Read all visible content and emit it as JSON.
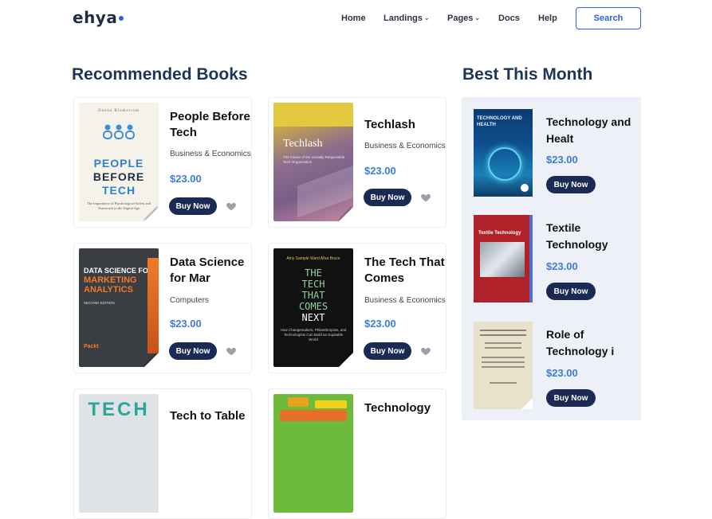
{
  "brand": {
    "logo": "ehya"
  },
  "nav": {
    "home": "Home",
    "landings": "Landings",
    "pages": "Pages",
    "docs": "Docs",
    "help": "Help",
    "search": "Search"
  },
  "recommended": {
    "title": "Recommended Books",
    "books": [
      {
        "title_line1": "People Before",
        "title_line2": "Tech",
        "category": "Business & Economics",
        "price": "$23.00",
        "buy": "Buy Now",
        "cover_author": "Duena Blomstrom",
        "cover_title": [
          "PEOPLE",
          "BEFORE",
          "TECH"
        ],
        "cover_subtitle": "The Importance of Psychological Safety and Teamwork in the Digital Age"
      },
      {
        "title_line1": "Techlash",
        "title_line2": "",
        "category": "Business & Economics",
        "price": "$23.00",
        "buy": "Buy Now",
        "cover_title": "Techlash",
        "cover_subtitle": "The Future of the Socially Responsible Tech Organization"
      },
      {
        "title_line1": "Data Science",
        "title_line2": "for Mar",
        "category": "Computers",
        "price": "$23.00",
        "buy": "Buy Now",
        "cover_title": [
          "DATA SCIENCE FOR",
          "MARKETING",
          "ANALYTICS"
        ],
        "cover_edition": "SECOND EDITION",
        "cover_brand": "Packt"
      },
      {
        "title_line1": "The Tech That",
        "title_line2": "Comes",
        "category": "Business & Economics",
        "price": "$23.00",
        "buy": "Buy Now",
        "cover_author": "Amy Sample Ward  Afua Bruce",
        "cover_title": [
          "THE",
          "TECH",
          "THAT",
          "COMES",
          "NEXT"
        ],
        "cover_subtitle": "How Changemakers, Philanthropists, and Technologists Can Build an Equitable World"
      },
      {
        "title_line1": "Tech to Table",
        "title_line2": "",
        "category": "",
        "price": "",
        "buy": "",
        "cover_title": "TECH"
      },
      {
        "title_line1": "Technology",
        "title_line2": "",
        "category": "",
        "price": "",
        "buy": ""
      }
    ]
  },
  "best": {
    "title": "Best This Month",
    "books": [
      {
        "title_line1": "Technology and",
        "title_line2": "Healt",
        "price": "$23.00",
        "buy": "Buy Now",
        "cover_title": "TECHNOLOGY AND HEALTH"
      },
      {
        "title_line1": "Textile",
        "title_line2": "Technology",
        "price": "$23.00",
        "buy": "Buy Now",
        "cover_title": "Textile Technology"
      },
      {
        "title_line1": "Role of",
        "title_line2": "Technology i",
        "price": "$23.00",
        "buy": "Buy Now"
      }
    ]
  },
  "colors": {
    "accent": "#2f5fe0",
    "navy": "#1b2a55",
    "price": "#3d7bd9",
    "heading": "#1d3557",
    "panel": "#edf1f7"
  }
}
